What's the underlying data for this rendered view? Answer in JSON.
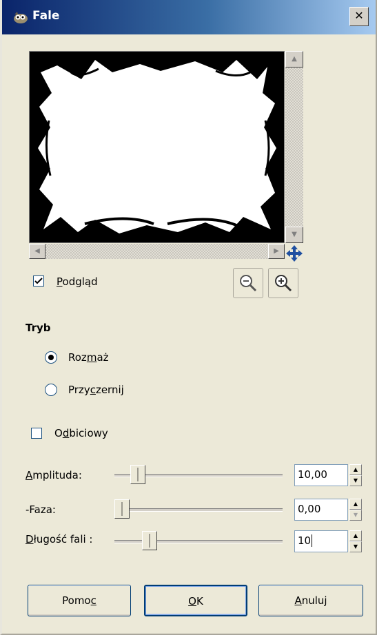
{
  "window": {
    "title": "Fale",
    "close_glyph": "✕"
  },
  "preview": {
    "checkbox_label_before": "",
    "checkbox_label_u": "P",
    "checkbox_label_after": "odgląd",
    "checked": true
  },
  "mode": {
    "heading": "Tryb",
    "options": [
      {
        "pre": "Roz",
        "u": "m",
        "post": "aż",
        "selected": true
      },
      {
        "pre": "Przy",
        "u": "c",
        "post": "zernij",
        "selected": false
      }
    ]
  },
  "reflective": {
    "pre": "O",
    "u": "d",
    "post": "biciowy",
    "checked": false
  },
  "sliders": [
    {
      "pre": "",
      "u": "A",
      "post": "mplituda:",
      "value": "10,00",
      "level": 0.1,
      "down_disabled": false
    },
    {
      "pre": "-Faza:",
      "u": "",
      "post": "",
      "value": "0,00",
      "level": 0.0,
      "down_disabled": true
    },
    {
      "pre": "",
      "u": "D",
      "post": "ługość fali :",
      "value": "10",
      "level": 0.2,
      "down_disabled": false
    }
  ],
  "buttons": {
    "help": {
      "pre": "Pomo",
      "u": "c",
      "post": ""
    },
    "ok": {
      "pre": "",
      "u": "O",
      "post": "K"
    },
    "cancel": {
      "pre": "",
      "u": "A",
      "post": "nuluj"
    }
  },
  "icons": {
    "app": "gimp-wilber-icon",
    "zoom_out": "zoom-out-icon",
    "zoom_in": "zoom-in-icon",
    "navigate": "navigate-cross-icon"
  },
  "colors": {
    "title_gradient_start": "#0a246a",
    "title_gradient_end": "#a6caf0",
    "nav_icon": "#1f4fa0"
  }
}
